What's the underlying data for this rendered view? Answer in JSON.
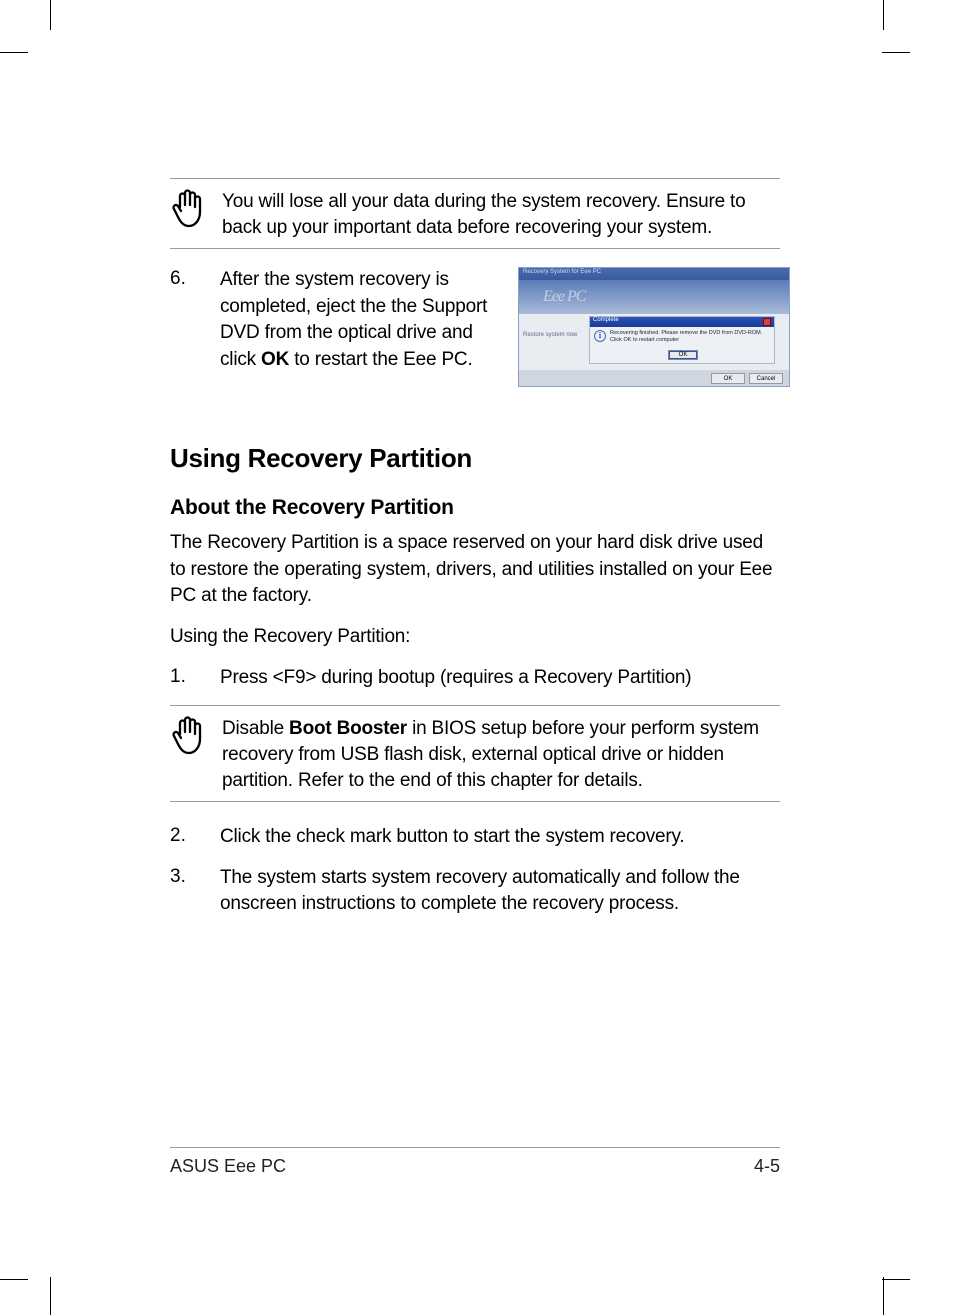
{
  "note1": {
    "text": "You will lose all your data during the system recovery. Ensure to back up your important data before recovering your system."
  },
  "step6": {
    "num": "6.",
    "pre": "After the system recovery is completed, eject the the Support DVD from the optical drive and click ",
    "bold": "OK",
    "post": " to restart the Eee PC."
  },
  "screenshot": {
    "title": "Recovery System for Eee PC",
    "banner": "Eee PC",
    "leftlbl": "Restore system now",
    "dlg_title": "Complete",
    "dlg_msg1": "Recovering finished. Please remove the DVD from DVD-ROM.",
    "dlg_msg2": "Click OK to restart computer",
    "dlg_ok": "OK",
    "f_ok": "OK",
    "f_cancel": "Cancel"
  },
  "h2": "Using Recovery Partition",
  "h3": "About the Recovery Partition",
  "p1": "The Recovery Partition is a space reserved on your hard disk drive used to restore the operating system, drivers, and utilities installed on your Eee PC at the factory.",
  "p2": "Using the Recovery Partition:",
  "step1": {
    "num": "1.",
    "text": "Press <F9> during bootup (requires a Recovery Partition)"
  },
  "note2": {
    "pre": "Disable ",
    "bold": "Boot Booster",
    "post": " in BIOS setup before your perform system recovery from USB flash disk, external optical drive or hidden partition. Refer to the end of this chapter for details."
  },
  "step2": {
    "num": "2.",
    "text": "Click the check mark button to start the system recovery."
  },
  "step3": {
    "num": "3.",
    "text": "The system starts system recovery automatically and follow the onscreen instructions to complete the recovery process."
  },
  "footer": {
    "left": "ASUS Eee PC",
    "right": "4-5"
  }
}
